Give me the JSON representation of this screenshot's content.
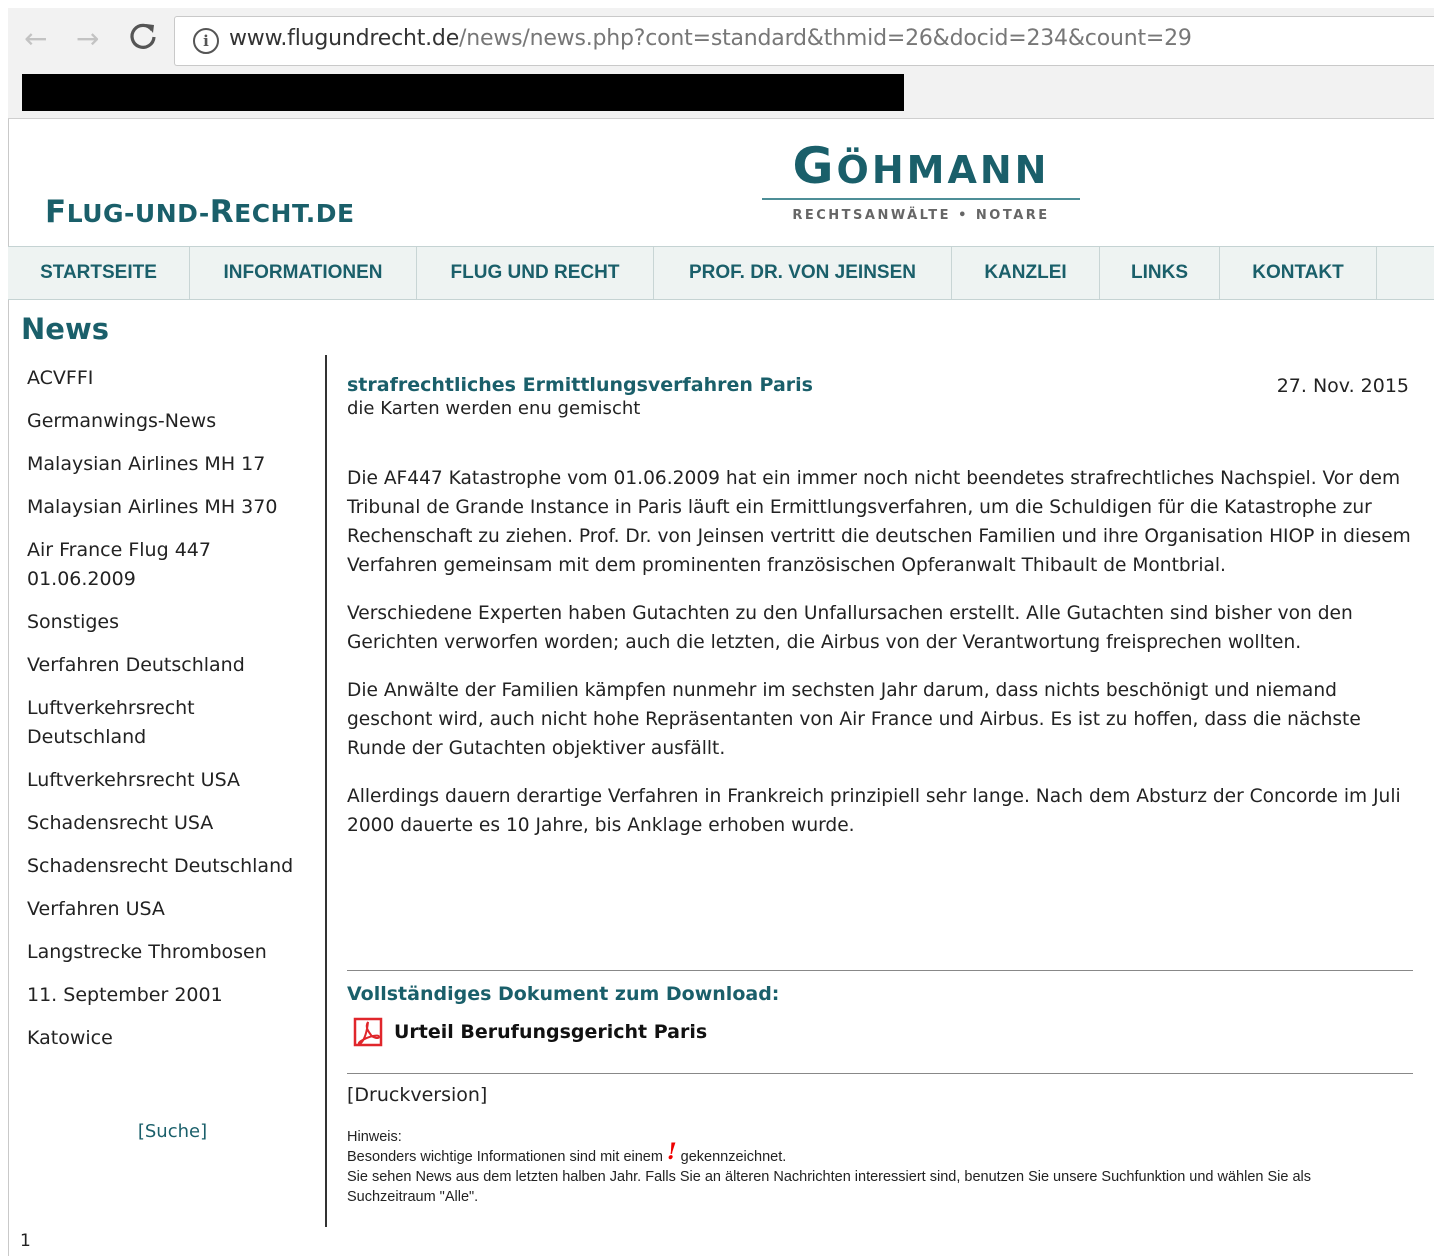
{
  "browser": {
    "back_glyph": "←",
    "forward_glyph": "→",
    "reload_glyph": "C",
    "info_glyph": "i",
    "url_domain": "www.flugundrecht.de",
    "url_path": "/news/news.php?cont=standard&thmid=26&docid=234&count=29"
  },
  "header": {
    "site_logo_first": "F",
    "site_logo_rest": "LUG-UND-",
    "site_logo_r": "R",
    "site_logo_tail": "ECHT.DE",
    "firm_initial": "G",
    "firm_rest": "ÖHMANN",
    "firm_subtitle": "RECHTSANWÄLTE • NOTARE"
  },
  "nav": {
    "items": [
      {
        "label": "STARTSEITE"
      },
      {
        "label": "INFORMATIONEN"
      },
      {
        "label": "FLUG UND RECHT"
      },
      {
        "label": "PROF. DR. VON JEINSEN"
      },
      {
        "label": "KANZLEI"
      },
      {
        "label": "LINKS"
      },
      {
        "label": "KONTAKT"
      }
    ]
  },
  "section_title": "News",
  "sidebar": {
    "items": [
      {
        "label": "ACVFFI"
      },
      {
        "label": "Germanwings-News"
      },
      {
        "label": "Malaysian Airlines MH 17"
      },
      {
        "label": "Malaysian Airlines MH 370"
      },
      {
        "label": "Air France Flug 447 01.06.2009"
      },
      {
        "label": "Sonstiges"
      },
      {
        "label": "Verfahren Deutschland"
      },
      {
        "label": "Luftverkehrsrecht Deutschland"
      },
      {
        "label": "Luftverkehrsrecht USA"
      },
      {
        "label": "Schadensrecht USA"
      },
      {
        "label": "Schadensrecht Deutschland"
      },
      {
        "label": "Verfahren USA"
      },
      {
        "label": "Langstrecke Thrombosen"
      },
      {
        "label": "11. September 2001"
      },
      {
        "label": "Katowice"
      }
    ],
    "search_label": "[Suche]",
    "page_number": "1"
  },
  "article": {
    "title": "strafrechtliches Ermittlungsverfahren Paris",
    "date": "27. Nov. 2015",
    "subtitle": "die Karten werden enu gemischt",
    "paragraphs": [
      "Die AF447 Katastrophe vom 01.06.2009 hat ein immer noch nicht beendetes strafrechtliches Nachspiel. Vor dem Tribunal de Grande Instance in Paris läuft ein Ermittlungsverfahren, um die Schuldigen für die Katastrophe zur Rechenschaft zu ziehen. Prof. Dr. von Jeinsen vertritt die deutschen Familien und ihre Organisation HIOP in diesem Verfahren gemeinsam mit dem prominenten französischen Opferanwalt Thibault de Montbrial.",
      "Verschiedene Experten haben Gutachten zu den Unfallursachen erstellt. Alle Gutachten sind bisher von den Gerichten verworfen worden; auch die letzten, die Airbus von der Verantwortung freisprechen wollten.",
      "Die Anwälte der Familien kämpfen nunmehr im sechsten Jahr darum, dass nichts beschönigt und niemand geschont wird, auch nicht hohe Repräsentanten von Air France und Airbus. Es ist zu hoffen, dass die nächste Runde der Gutachten objektiver ausfällt.",
      "Allerdings dauern derartige Verfahren in Frankreich prinzipiell sehr lange. Nach dem Absturz der Concorde im Juli 2000 dauerte es 10 Jahre, bis Anklage erhoben wurde."
    ],
    "download_heading": "Vollständiges Dokument zum Download:",
    "download_link": "Urteil Berufungsgericht Paris",
    "print_link": "[Druckversion]",
    "hint_label": "Hinweis:",
    "hint_line1_before": "Besonders wichtige Informationen sind mit einem",
    "hint_mark": "!",
    "hint_line1_after": "gekennzeichnet.",
    "hint_line2": "Sie sehen News aus dem letzten halben Jahr. Falls Sie an älteren Nachrichten interessiert sind, benutzen Sie unsere Suchfunktion und wählen Sie als Suchzeitraum \"Alle\"."
  },
  "colors": {
    "accent": "#1a5f6a",
    "pdf_icon": "#e0262b",
    "hint_mark": "#ee0000"
  }
}
